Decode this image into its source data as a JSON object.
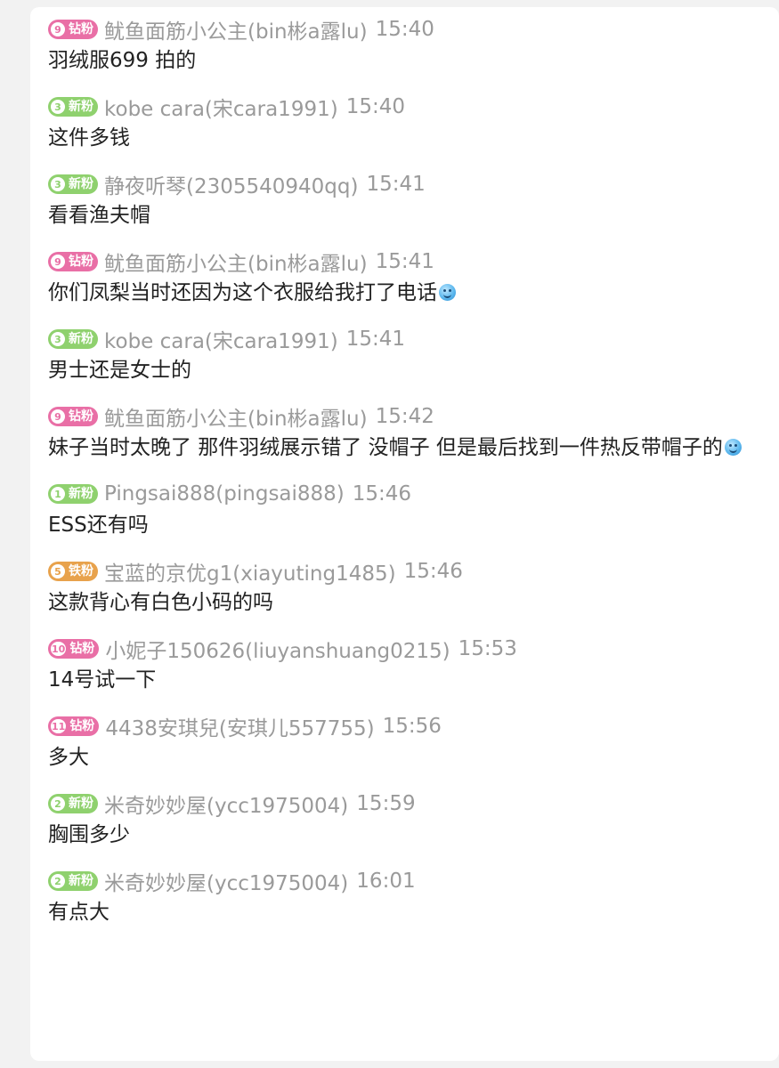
{
  "badge_colors": {
    "diamond": "#e96fa6",
    "new": "#8fd16e",
    "iron": "#e8a24c"
  },
  "messages": [
    {
      "badge": {
        "level": "9",
        "label": "钻粉",
        "type": "diamond"
      },
      "user": "鱿鱼面筋小公主(bin彬a露lu)",
      "time": "15:40",
      "text": "羽绒服699 拍的",
      "emoji": false
    },
    {
      "badge": {
        "level": "3",
        "label": "新粉",
        "type": "new"
      },
      "user": "kobe cara(宋cara1991)",
      "time": "15:40",
      "text": "这件多钱",
      "emoji": false
    },
    {
      "badge": {
        "level": "3",
        "label": "新粉",
        "type": "new"
      },
      "user": "静夜听琴(2305540940qq)",
      "time": "15:41",
      "text": "看看渔夫帽",
      "emoji": false
    },
    {
      "badge": {
        "level": "9",
        "label": "钻粉",
        "type": "diamond"
      },
      "user": "鱿鱼面筋小公主(bin彬a露lu)",
      "time": "15:41",
      "text": "你们凤梨当时还因为这个衣服给我打了电话",
      "emoji": true
    },
    {
      "badge": {
        "level": "3",
        "label": "新粉",
        "type": "new"
      },
      "user": "kobe cara(宋cara1991)",
      "time": "15:41",
      "text": "男士还是女士的",
      "emoji": false
    },
    {
      "badge": {
        "level": "9",
        "label": "钻粉",
        "type": "diamond"
      },
      "user": "鱿鱼面筋小公主(bin彬a露lu)",
      "time": "15:42",
      "text": "妹子当时太晚了 那件羽绒展示错了 没帽子 但是最后找到一件热反带帽子的",
      "emoji": true
    },
    {
      "badge": {
        "level": "1",
        "label": "新粉",
        "type": "new"
      },
      "user": "Pingsai888(pingsai888)",
      "time": "15:46",
      "text": "ESS还有吗",
      "emoji": false
    },
    {
      "badge": {
        "level": "5",
        "label": "铁粉",
        "type": "iron"
      },
      "user": "宝蓝的京优g1(xiayuting1485)",
      "time": "15:46",
      "text": "这款背心有白色小码的吗",
      "emoji": false
    },
    {
      "badge": {
        "level": "10",
        "label": "钻粉",
        "type": "diamond"
      },
      "user": "小妮子150626(liuyanshuang0215)",
      "time": "15:53",
      "text": "14号试一下",
      "emoji": false
    },
    {
      "badge": {
        "level": "11",
        "label": "钻粉",
        "type": "diamond"
      },
      "user": "4438安琪兒(安琪儿557755)",
      "time": "15:56",
      "text": "多大",
      "emoji": false
    },
    {
      "badge": {
        "level": "2",
        "label": "新粉",
        "type": "new"
      },
      "user": "米奇妙妙屋(ycc1975004)",
      "time": "15:59",
      "text": "胸围多少",
      "emoji": false
    },
    {
      "badge": {
        "level": "2",
        "label": "新粉",
        "type": "new"
      },
      "user": "米奇妙妙屋(ycc1975004)",
      "time": "16:01",
      "text": "有点大",
      "emoji": false
    }
  ]
}
